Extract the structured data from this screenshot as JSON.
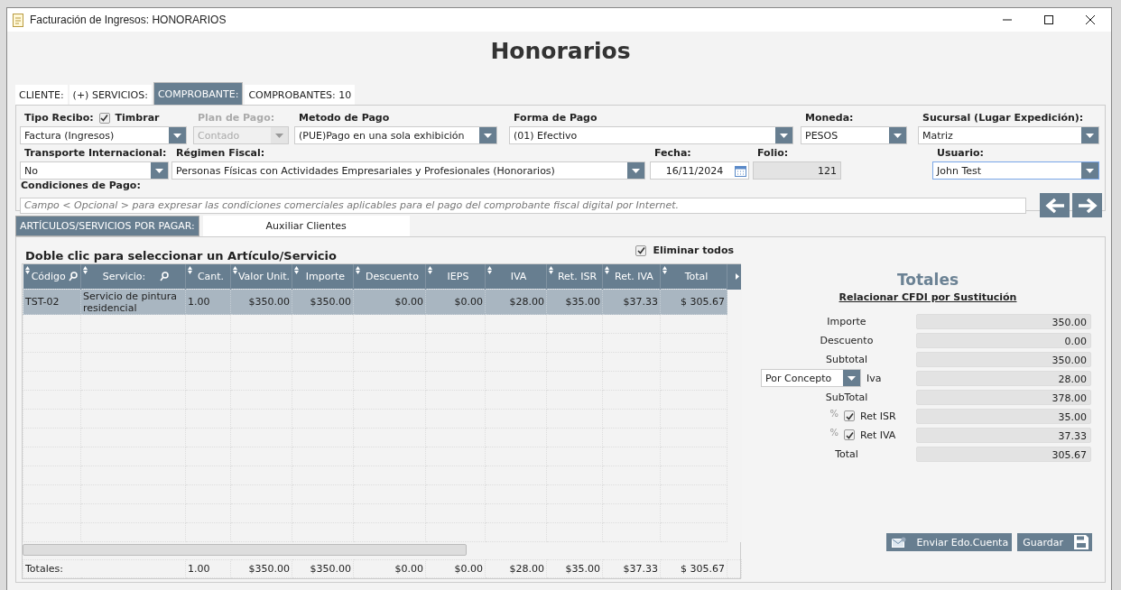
{
  "window": {
    "title": "Facturación de Ingresos: HONORARIOS"
  },
  "heading": "Honorarios",
  "tabs": [
    {
      "label": "CLIENTE:",
      "selected": false
    },
    {
      "label": "(+) SERVICIOS:",
      "selected": false
    },
    {
      "label": "COMPROBANTE:",
      "selected": true
    },
    {
      "label": "COMPROBANTES: 10",
      "selected": false
    }
  ],
  "form": {
    "fields": [
      {
        "kind": "select",
        "label": "Tipo Recibo:",
        "value": "Factura (Ingresos)",
        "disabled": false,
        "checkbox": {
          "label": "Timbrar",
          "checked": true
        }
      },
      {
        "kind": "select",
        "label": "Plan de Pago:",
        "value": "Contado",
        "disabled": true
      },
      {
        "kind": "select",
        "label": "Metodo de Pago",
        "value": "(PUE)Pago en una sola exhibición",
        "disabled": false
      },
      {
        "kind": "select",
        "label": "Forma de Pago",
        "value": "(01) Efectivo",
        "disabled": false
      },
      {
        "kind": "select",
        "label": "Moneda:",
        "value": "PESOS",
        "disabled": false
      },
      {
        "kind": "select",
        "label": "Sucursal (Lugar Expedición):",
        "value": "Matriz",
        "disabled": false
      },
      {
        "kind": "select",
        "label": "Transporte Internacional:",
        "value": "No",
        "disabled": false
      },
      {
        "kind": "select",
        "label": "Régimen Fiscal:",
        "value": "Personas Físicas con Actividades Empresariales y Profesionales (Honorarios)",
        "disabled": false
      },
      {
        "kind": "date",
        "label": "Fecha:",
        "value": "16/11/2024",
        "disabled": false
      },
      {
        "kind": "readonly",
        "label": "Folio:",
        "value": "121",
        "disabled": false
      },
      {
        "kind": "select",
        "label": "Usuario:",
        "value": "John Test",
        "disabled": false,
        "focused": true
      }
    ],
    "conditions": {
      "label": "Condiciones de Pago:",
      "placeholder": "Campo < Opcional > para expresar las condiciones comerciales aplicables para el pago del comprobante fiscal digital por Internet."
    }
  },
  "lower_tabs": [
    {
      "label": "ARTÍCULOS/SERVICIOS POR PAGAR:",
      "selected": true
    },
    {
      "label": "Auxiliar Clientes",
      "selected": false
    }
  ],
  "grid": {
    "title": "Doble clic para seleccionar un Artículo/Servicio",
    "delete_all": {
      "label": "Eliminar todos",
      "checked": true
    },
    "columns": [
      {
        "label": "Código",
        "search": true
      },
      {
        "label": "Servicio:",
        "search": true
      },
      {
        "label": "Cant.",
        "search": false
      },
      {
        "label": "Valor Unit.",
        "search": false
      },
      {
        "label": "Importe",
        "search": false
      },
      {
        "label": "Descuento",
        "search": false
      },
      {
        "label": "IEPS",
        "search": false
      },
      {
        "label": "IVA",
        "search": false
      },
      {
        "label": "Ret. ISR",
        "search": false
      },
      {
        "label": "Ret. IVA",
        "search": false
      },
      {
        "label": "Total",
        "search": false
      }
    ],
    "rows": [
      {
        "selected": true,
        "cells": [
          "TST-02",
          "Servicio de pintura residencial",
          "1.00",
          "$350.00",
          "$350.00",
          "$0.00",
          "$0.00",
          "$28.00",
          "$35.00",
          "$37.33",
          "$ 305.67"
        ]
      }
    ],
    "totals": {
      "label": "Totales:",
      "values": [
        "1.00",
        "$350.00",
        "$350.00",
        "$0.00",
        "$0.00",
        "$28.00",
        "$35.00",
        "$37.33",
        "$ 305.67"
      ]
    }
  },
  "totals_panel": {
    "title": "Totales",
    "link": "Relacionar CFDI por Sustitución",
    "rows": [
      {
        "kind": "plain",
        "label": "Importe",
        "value": "350.00"
      },
      {
        "kind": "plain",
        "label": "Descuento",
        "value": "0.00"
      },
      {
        "kind": "plain",
        "label": "Subtotal",
        "value": "350.00"
      },
      {
        "kind": "select",
        "select": "Por Concepto",
        "label": "Iva",
        "value": "28.00"
      },
      {
        "kind": "plain",
        "label": "SubTotal",
        "value": "378.00"
      },
      {
        "kind": "check",
        "prefix": "%",
        "checked": true,
        "label": "Ret ISR",
        "value": "35.00"
      },
      {
        "kind": "check",
        "prefix": "%",
        "checked": true,
        "label": "Ret IVA",
        "value": "37.33"
      },
      {
        "kind": "plain",
        "label": "Total",
        "value": "305.67"
      }
    ]
  },
  "buttons": [
    {
      "kind": "mail",
      "label": "Enviar Edo.Cuenta"
    },
    {
      "kind": "save",
      "label": "Guardar"
    }
  ]
}
